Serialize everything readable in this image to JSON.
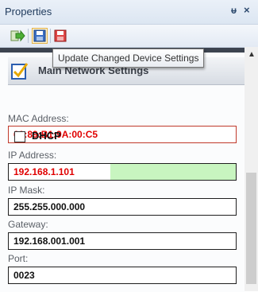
{
  "window": {
    "title": "Properties",
    "pin_glyph": "ᵾ",
    "close_glyph": "×"
  },
  "toolbar": {
    "buttons": [
      {
        "name": "refresh-device-button",
        "icon": "green-arrow-icon"
      },
      {
        "name": "update-changed-settings-button",
        "icon": "blue-floppy-icon"
      },
      {
        "name": "update-all-settings-button",
        "icon": "red-floppy-icon"
      }
    ]
  },
  "tooltip": {
    "text": "Update Changed Device Settings"
  },
  "group": {
    "title": "Main Network Settings"
  },
  "fields": {
    "mac": {
      "label": "MAC Address:",
      "value": "60:89:B1:9A:00:C5"
    },
    "dhcp": {
      "label": "DHCP",
      "checked": false
    },
    "ip": {
      "label": "IP Address:",
      "value": "192.168.1.101"
    },
    "mask": {
      "label": "IP Mask:",
      "value": "255.255.000.000"
    },
    "gateway": {
      "label": "Gateway:",
      "value": "192.168.001.001"
    },
    "port": {
      "label": "Port:",
      "value": "0023"
    }
  },
  "colors": {
    "modified_text": "#e00000",
    "modified_bg": "#c8f5c0"
  }
}
